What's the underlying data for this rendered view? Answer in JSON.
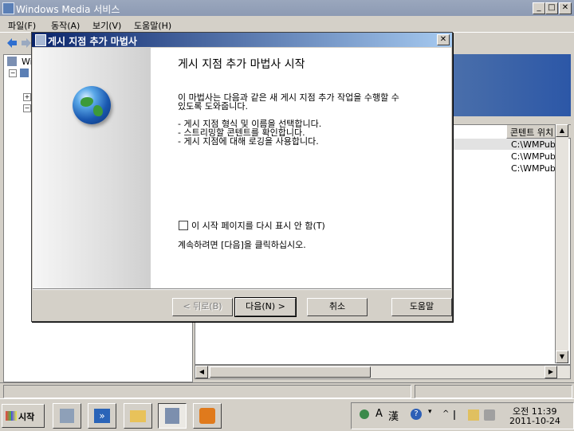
{
  "main_window": {
    "title": "Windows Media 서비스",
    "min": "_",
    "max": "□",
    "close": "✕"
  },
  "menu": [
    "파일(F)",
    "동작(A)",
    "보기(V)",
    "도움말(H)"
  ],
  "tree": {
    "root_label": "Wi"
  },
  "list": {
    "column_header": "콘텐트 위치",
    "rows": [
      "C:\\WMPub",
      "C:\\WMPub",
      "C:\\WMPub"
    ]
  },
  "dialog": {
    "title": "게시 지점 추가 마법사",
    "close": "✕",
    "heading": "게시 지점 추가 마법사 시작",
    "intro_line1": "이 마법사는 다음과 같은 새 게시 지점 추가 작업을 수행할 수",
    "intro_line2": "있도록 도와줍니다.",
    "tasks": [
      "- 게시 지점 형식 및 이름을 선택합니다.",
      "- 스트리밍할 콘텐트를 확인합니다.",
      "- 게시 지점에 대해 로깅을 사용합니다."
    ],
    "checkbox_label": "이 시작 페이지를 다시 표시 안 함(T)",
    "checkbox_checked": false,
    "continue_text": "계속하려면 [다음]을 클릭하십시오.",
    "buttons": {
      "back": "< 뒤로(B)",
      "next": "다음(N) >",
      "cancel": "취소",
      "help": "도움말"
    }
  },
  "taskbar": {
    "start_label": "시작",
    "ime_a": "A",
    "ime_han": "漢",
    "clock_time": "오전 11:39",
    "clock_date": "2011-10-24"
  }
}
